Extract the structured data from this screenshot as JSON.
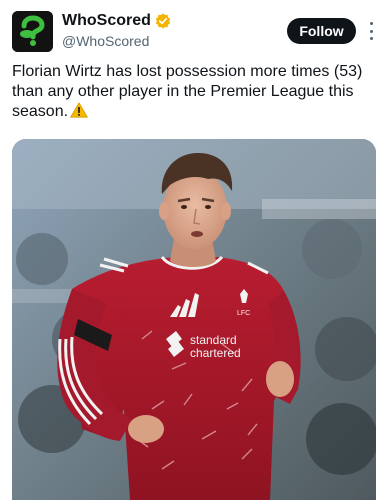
{
  "account": {
    "display_name": "WhoScored",
    "handle": "@WhoScored",
    "avatar_icon": "whoscored-logo-icon",
    "verified_icon": "verified-badge-icon",
    "verified_color": "#f4b400"
  },
  "actions": {
    "follow_label": "Follow",
    "more_icon": "more-vertical-icon"
  },
  "tweet": {
    "text": "Florian Wirtz has lost possession more times (53) than any other player in the Premier League this season.",
    "emoji_icon": "warning-sign-icon"
  },
  "media": {
    "description_icon": "player-photo",
    "sponsor_line1": "standard",
    "sponsor_line2": "chartered",
    "crest_text": "LFC"
  },
  "colors": {
    "text": "#0f1419",
    "muted": "#536471",
    "button_bg": "#0f1419",
    "shirt_red": "#a8192a"
  }
}
